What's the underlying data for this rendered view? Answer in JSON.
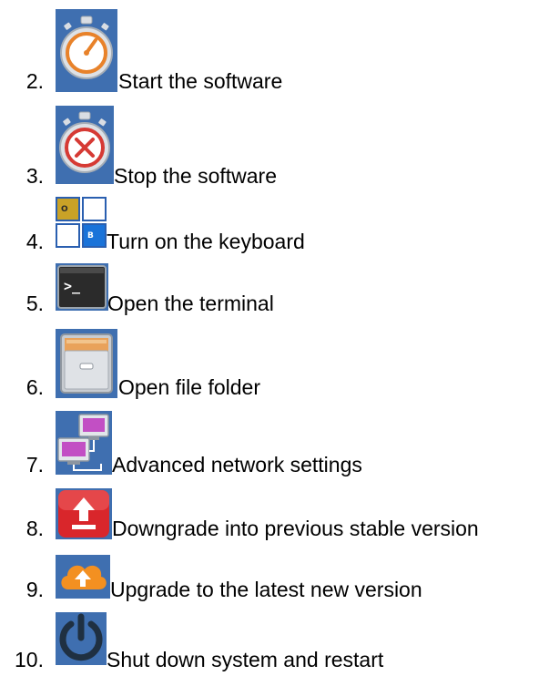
{
  "items": [
    {
      "number": "2.",
      "icon": "stopwatch-start-icon",
      "label": "Start the software"
    },
    {
      "number": "3.",
      "icon": "stopwatch-stop-icon",
      "label": "Stop the software"
    },
    {
      "number": "4.",
      "icon": "keyboard-icon",
      "label": "Turn on the keyboard"
    },
    {
      "number": "5.",
      "icon": "terminal-icon",
      "label": "Open the terminal"
    },
    {
      "number": "6.",
      "icon": "file-cabinet-icon",
      "label": "Open file folder"
    },
    {
      "number": "7.",
      "icon": "network-icon",
      "label": "Advanced network settings"
    },
    {
      "number": "8.",
      "icon": "downgrade-icon",
      "label": "Downgrade into previous stable version"
    },
    {
      "number": "9.",
      "icon": "cloud-upgrade-icon",
      "label": "Upgrade to the latest new version"
    },
    {
      "number": "10.",
      "icon": "power-icon",
      "label": "Shut down system and restart"
    }
  ],
  "icons": {
    "keyboard_keys": [
      "O",
      "B"
    ],
    "terminal_prompt": ">_"
  },
  "colors": {
    "icon_background": "#3f6fb0",
    "stopwatch_start": "#e8822a",
    "stopwatch_stop": "#d63a34",
    "keyboard_blue": "#1a73d9",
    "keyboard_yellow": "#c9a227",
    "downgrade_red": "#d9262b",
    "cloud_orange": "#f39021",
    "power_dark": "#1f3042"
  }
}
